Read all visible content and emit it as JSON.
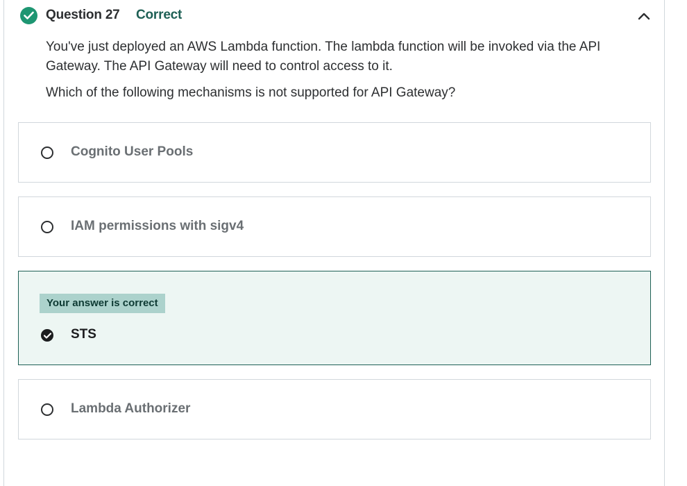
{
  "question": {
    "number_label": "Question 27",
    "status": "Correct",
    "status_color": "#1e6055",
    "icons": {
      "status": "check-circle-icon",
      "collapse": "chevron-up-icon"
    },
    "prompt_line1": "You've just deployed an AWS Lambda function. The lambda function will be invoked via the API Gateway. The API Gateway will need to control access to it.",
    "prompt_line2": "Which of the following mechanisms is not supported for API Gateway?"
  },
  "options": [
    {
      "label": "Cognito User Pools",
      "selected": false
    },
    {
      "label": "IAM permissions with sigv4",
      "selected": false
    },
    {
      "label": "STS",
      "selected": true,
      "feedback": "Your answer is correct"
    },
    {
      "label": "Lambda Authorizer",
      "selected": false
    }
  ]
}
